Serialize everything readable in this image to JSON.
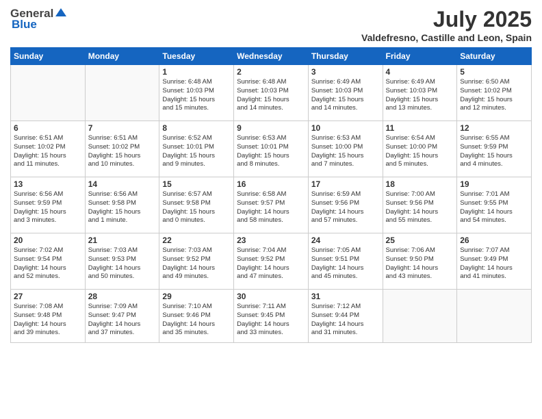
{
  "logo": {
    "general": "General",
    "blue": "Blue"
  },
  "title": "July 2025",
  "location": "Valdefresno, Castille and Leon, Spain",
  "weekdays": [
    "Sunday",
    "Monday",
    "Tuesday",
    "Wednesday",
    "Thursday",
    "Friday",
    "Saturday"
  ],
  "weeks": [
    [
      {
        "day": "",
        "info": ""
      },
      {
        "day": "",
        "info": ""
      },
      {
        "day": "1",
        "info": "Sunrise: 6:48 AM\nSunset: 10:03 PM\nDaylight: 15 hours\nand 15 minutes."
      },
      {
        "day": "2",
        "info": "Sunrise: 6:48 AM\nSunset: 10:03 PM\nDaylight: 15 hours\nand 14 minutes."
      },
      {
        "day": "3",
        "info": "Sunrise: 6:49 AM\nSunset: 10:03 PM\nDaylight: 15 hours\nand 14 minutes."
      },
      {
        "day": "4",
        "info": "Sunrise: 6:49 AM\nSunset: 10:03 PM\nDaylight: 15 hours\nand 13 minutes."
      },
      {
        "day": "5",
        "info": "Sunrise: 6:50 AM\nSunset: 10:02 PM\nDaylight: 15 hours\nand 12 minutes."
      }
    ],
    [
      {
        "day": "6",
        "info": "Sunrise: 6:51 AM\nSunset: 10:02 PM\nDaylight: 15 hours\nand 11 minutes."
      },
      {
        "day": "7",
        "info": "Sunrise: 6:51 AM\nSunset: 10:02 PM\nDaylight: 15 hours\nand 10 minutes."
      },
      {
        "day": "8",
        "info": "Sunrise: 6:52 AM\nSunset: 10:01 PM\nDaylight: 15 hours\nand 9 minutes."
      },
      {
        "day": "9",
        "info": "Sunrise: 6:53 AM\nSunset: 10:01 PM\nDaylight: 15 hours\nand 8 minutes."
      },
      {
        "day": "10",
        "info": "Sunrise: 6:53 AM\nSunset: 10:00 PM\nDaylight: 15 hours\nand 7 minutes."
      },
      {
        "day": "11",
        "info": "Sunrise: 6:54 AM\nSunset: 10:00 PM\nDaylight: 15 hours\nand 5 minutes."
      },
      {
        "day": "12",
        "info": "Sunrise: 6:55 AM\nSunset: 9:59 PM\nDaylight: 15 hours\nand 4 minutes."
      }
    ],
    [
      {
        "day": "13",
        "info": "Sunrise: 6:56 AM\nSunset: 9:59 PM\nDaylight: 15 hours\nand 3 minutes."
      },
      {
        "day": "14",
        "info": "Sunrise: 6:56 AM\nSunset: 9:58 PM\nDaylight: 15 hours\nand 1 minute."
      },
      {
        "day": "15",
        "info": "Sunrise: 6:57 AM\nSunset: 9:58 PM\nDaylight: 15 hours\nand 0 minutes."
      },
      {
        "day": "16",
        "info": "Sunrise: 6:58 AM\nSunset: 9:57 PM\nDaylight: 14 hours\nand 58 minutes."
      },
      {
        "day": "17",
        "info": "Sunrise: 6:59 AM\nSunset: 9:56 PM\nDaylight: 14 hours\nand 57 minutes."
      },
      {
        "day": "18",
        "info": "Sunrise: 7:00 AM\nSunset: 9:56 PM\nDaylight: 14 hours\nand 55 minutes."
      },
      {
        "day": "19",
        "info": "Sunrise: 7:01 AM\nSunset: 9:55 PM\nDaylight: 14 hours\nand 54 minutes."
      }
    ],
    [
      {
        "day": "20",
        "info": "Sunrise: 7:02 AM\nSunset: 9:54 PM\nDaylight: 14 hours\nand 52 minutes."
      },
      {
        "day": "21",
        "info": "Sunrise: 7:03 AM\nSunset: 9:53 PM\nDaylight: 14 hours\nand 50 minutes."
      },
      {
        "day": "22",
        "info": "Sunrise: 7:03 AM\nSunset: 9:52 PM\nDaylight: 14 hours\nand 49 minutes."
      },
      {
        "day": "23",
        "info": "Sunrise: 7:04 AM\nSunset: 9:52 PM\nDaylight: 14 hours\nand 47 minutes."
      },
      {
        "day": "24",
        "info": "Sunrise: 7:05 AM\nSunset: 9:51 PM\nDaylight: 14 hours\nand 45 minutes."
      },
      {
        "day": "25",
        "info": "Sunrise: 7:06 AM\nSunset: 9:50 PM\nDaylight: 14 hours\nand 43 minutes."
      },
      {
        "day": "26",
        "info": "Sunrise: 7:07 AM\nSunset: 9:49 PM\nDaylight: 14 hours\nand 41 minutes."
      }
    ],
    [
      {
        "day": "27",
        "info": "Sunrise: 7:08 AM\nSunset: 9:48 PM\nDaylight: 14 hours\nand 39 minutes."
      },
      {
        "day": "28",
        "info": "Sunrise: 7:09 AM\nSunset: 9:47 PM\nDaylight: 14 hours\nand 37 minutes."
      },
      {
        "day": "29",
        "info": "Sunrise: 7:10 AM\nSunset: 9:46 PM\nDaylight: 14 hours\nand 35 minutes."
      },
      {
        "day": "30",
        "info": "Sunrise: 7:11 AM\nSunset: 9:45 PM\nDaylight: 14 hours\nand 33 minutes."
      },
      {
        "day": "31",
        "info": "Sunrise: 7:12 AM\nSunset: 9:44 PM\nDaylight: 14 hours\nand 31 minutes."
      },
      {
        "day": "",
        "info": ""
      },
      {
        "day": "",
        "info": ""
      }
    ]
  ]
}
